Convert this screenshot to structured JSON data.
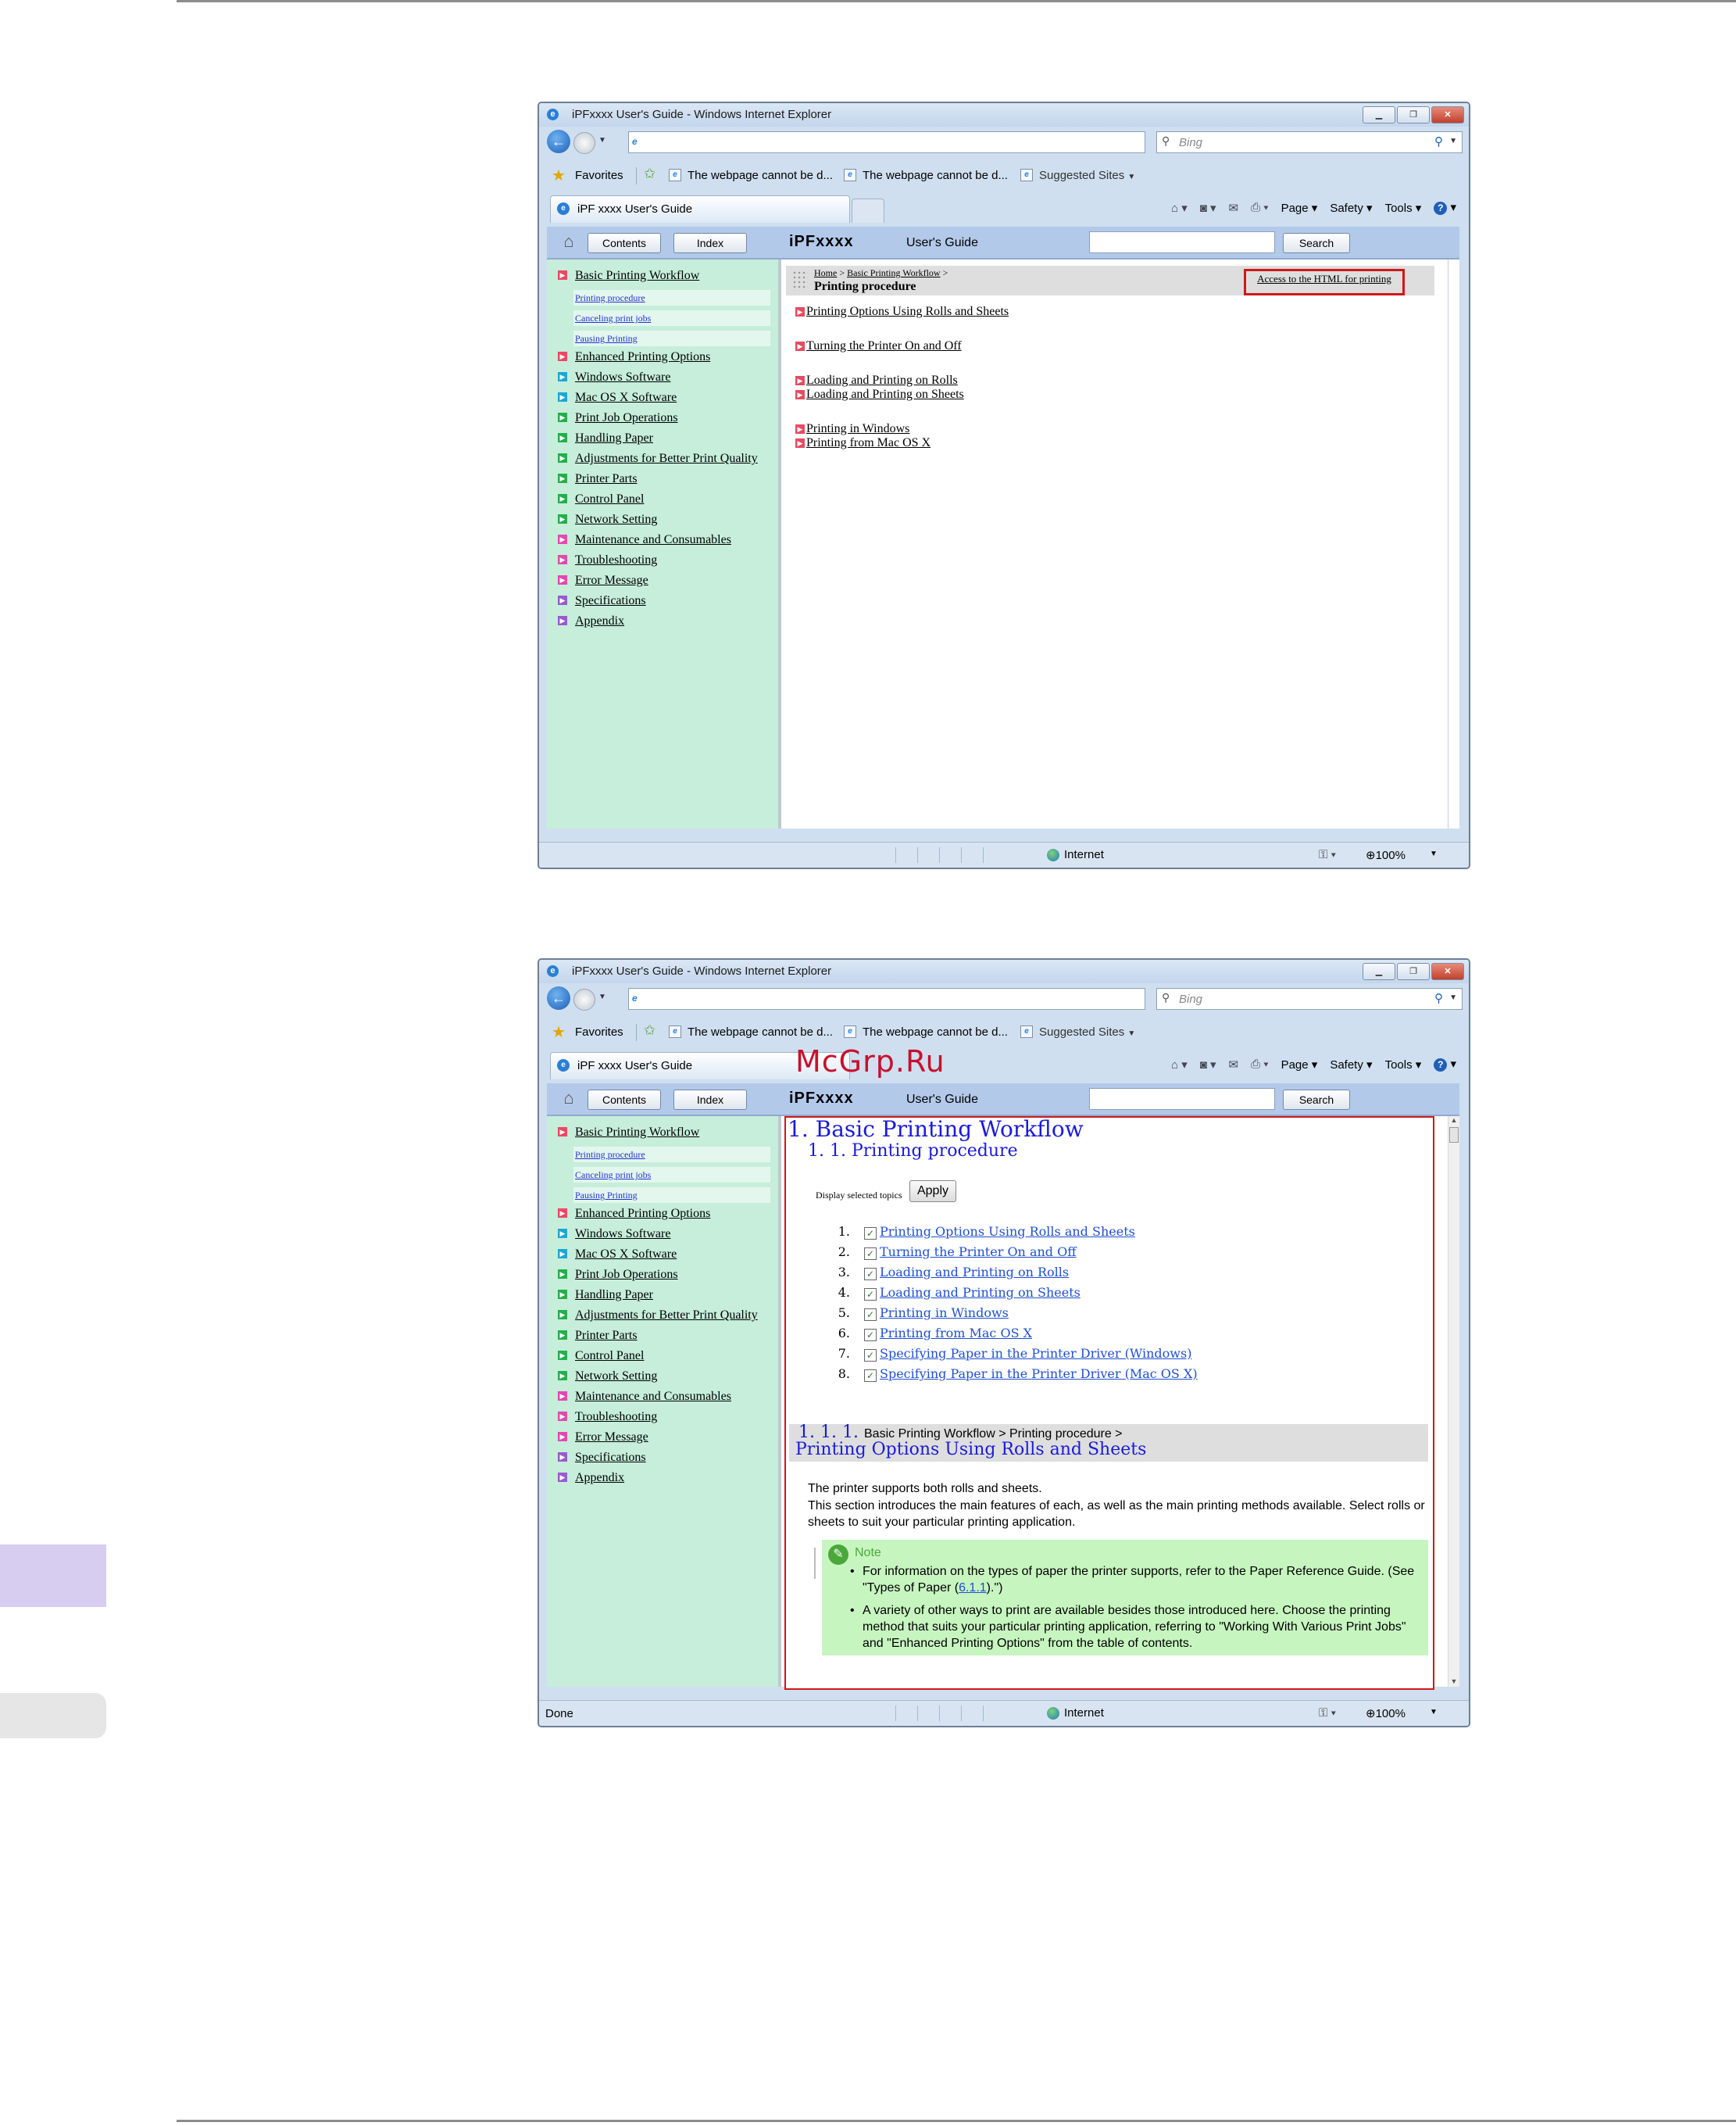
{
  "watermark": "McGrp.Ru",
  "browser": {
    "window_title": "iPFxxxx  User's Guide - Windows Internet Explorer",
    "search_placeholder": "Bing",
    "favorites_label": "Favorites",
    "fav_links": [
      "The webpage cannot be d...",
      "The webpage cannot be d...",
      "Suggested Sites"
    ],
    "tab_label": "iPF xxxx  User's Guide",
    "commands": [
      "Page",
      "Safety",
      "Tools"
    ],
    "status_zone": "Internet",
    "zoom": "100%"
  },
  "guide": {
    "contents_btn": "Contents",
    "index_btn": "Index",
    "brand": "iPFxxxx",
    "guide_label": "User's Guide",
    "search_btn": "Search"
  },
  "sidebar": {
    "items": [
      {
        "label": "Basic Printing Workflow",
        "color": "#e84a5f"
      },
      {
        "label": "Enhanced Printing Options",
        "color": "#e84a5f"
      },
      {
        "label": "Windows Software",
        "color": "#1aa8d8"
      },
      {
        "label": "Mac OS X Software",
        "color": "#1aa8d8"
      },
      {
        "label": "Print Job Operations",
        "color": "#22b04a"
      },
      {
        "label": "Handling Paper",
        "color": "#22b04a"
      },
      {
        "label": "Adjustments for Better Print Quality",
        "color": "#22b04a"
      },
      {
        "label": "Printer Parts",
        "color": "#22b04a"
      },
      {
        "label": "Control Panel",
        "color": "#22b04a"
      },
      {
        "label": "Network Setting",
        "color": "#22b04a"
      },
      {
        "label": "Maintenance and Consumables",
        "color": "#e04ab0"
      },
      {
        "label": "Troubleshooting",
        "color": "#e04ab0"
      },
      {
        "label": "Error Message",
        "color": "#e04ab0"
      },
      {
        "label": "Specifications",
        "color": "#9a5ad0"
      },
      {
        "label": "Appendix",
        "color": "#9a5ad0"
      }
    ],
    "subitems": [
      "Printing procedure",
      "Canceling print jobs",
      "Pausing Printing"
    ]
  },
  "screen1": {
    "breadcrumb": {
      "home": "Home",
      "sep1": " > ",
      "section": "Basic Printing Workflow",
      "sep2": " >"
    },
    "page_title": "Printing procedure",
    "access_button": "Access to the HTML for printing",
    "topics": [
      "Printing Options Using Rolls and Sheets",
      "Turning the Printer On and Off",
      "Loading and Printing on Rolls",
      "Loading and Printing on Sheets",
      "Printing in Windows",
      "Printing from Mac OS X"
    ]
  },
  "screen2": {
    "status_left": "Done",
    "h1": "1. Basic Printing Workflow",
    "h2": "1. 1. Printing procedure",
    "display_selected": "Display selected topics",
    "apply_btn": "Apply",
    "checklist": [
      {
        "num": "1.",
        "label": "Printing Options Using Rolls and Sheets",
        "checked": true
      },
      {
        "num": "2.",
        "label": "Turning the Printer On and Off",
        "checked": true
      },
      {
        "num": "3.",
        "label": "Loading and Printing on Rolls",
        "checked": true
      },
      {
        "num": "4.",
        "label": "Loading and Printing on Sheets",
        "checked": true
      },
      {
        "num": "5.",
        "label": "Printing in Windows",
        "checked": true
      },
      {
        "num": "6.",
        "label": "Printing from Mac OS X",
        "checked": true
      },
      {
        "num": "7.",
        "label": "Specifying Paper in the Printer Driver (Windows)",
        "checked": true
      },
      {
        "num": "8.",
        "label": "Specifying Paper in the Printer Driver (Mac OS X)",
        "checked": true
      }
    ],
    "section_number": "1. 1. 1.",
    "section_path": "Basic Printing Workflow > Printing procedure >",
    "section_title": "Printing Options Using Rolls and Sheets",
    "para1": "The printer supports both rolls and sheets.",
    "para2": "This section introduces the main features of each, as well as the main printing methods available. Select rolls or sheets to suit your particular printing application.",
    "note_title": "Note",
    "note_b1_pre": "For information on the types of paper the printer supports, refer to the Paper Reference Guide.  (See \"Types of Paper (",
    "note_b1_link": "6.1.1",
    "note_b1_post": ").\")",
    "note_b2": "A variety of other ways to print are available besides those introduced here. Choose the printing method that suits your particular printing application, referring to \"Working With Various Print Jobs\" and \"Enhanced Printing Options\" from the table of contents."
  }
}
